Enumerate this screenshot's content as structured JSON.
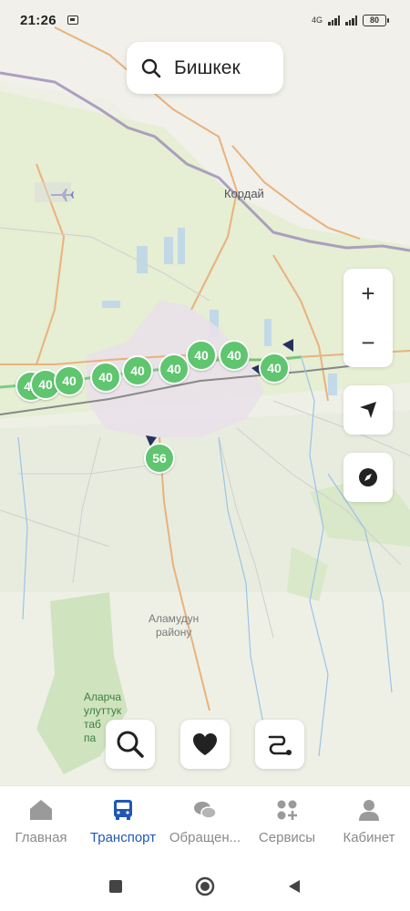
{
  "status": {
    "time": "21:26",
    "network": "4G",
    "battery": "80"
  },
  "search": {
    "label": "Бишкек",
    "icon": "search-icon"
  },
  "map": {
    "labels": {
      "town": "Кордай",
      "district": "Аламудун\nрайону",
      "park": "Аларча\nулуттук\nтаб\nпа"
    },
    "markers": [
      "40",
      "40",
      "40",
      "40",
      "40",
      "40",
      "40",
      "40",
      "40",
      "56"
    ]
  },
  "controls": {
    "zoom_in": "+",
    "zoom_out": "−"
  },
  "tabs": [
    {
      "label": "Главная",
      "icon": "home-icon"
    },
    {
      "label": "Транспорт",
      "icon": "bus-icon",
      "active": true
    },
    {
      "label": "Обращен...",
      "icon": "chat-icon"
    },
    {
      "label": "Сервисы",
      "icon": "services-icon"
    },
    {
      "label": "Кабинет",
      "icon": "profile-icon"
    }
  ],
  "colors": {
    "accent": "#1f57b8",
    "marker": "#5fc56f",
    "inactive": "#8a8a8a"
  }
}
